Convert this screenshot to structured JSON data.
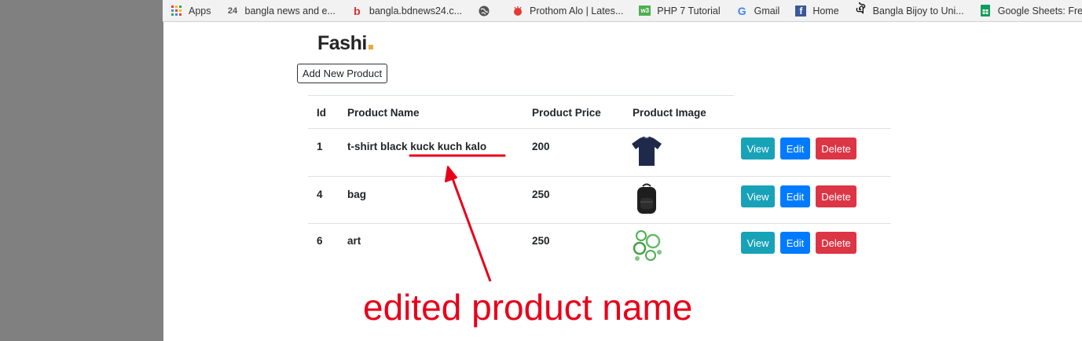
{
  "bookmarks": [
    {
      "label": "Apps",
      "icon": "apps-grid-icon"
    },
    {
      "label": "bangla news and e...",
      "icon": "news24-icon"
    },
    {
      "label": "bangla.bdnews24.c...",
      "icon": "bdnews-icon"
    },
    {
      "label": "",
      "icon": "globe-icon"
    },
    {
      "label": "Prothom Alo | Lates...",
      "icon": "prothomalo-icon"
    },
    {
      "label": "PHP 7 Tutorial",
      "icon": "w3-icon"
    },
    {
      "label": "Gmail",
      "icon": "google-icon"
    },
    {
      "label": "Home",
      "icon": "facebook-icon"
    },
    {
      "label": "Bangla Bijoy to Uni...",
      "icon": "bijoy-icon"
    },
    {
      "label": "Google Sheets: Free...",
      "icon": "sheets-icon"
    },
    {
      "label": "",
      "icon": "google-icon"
    }
  ],
  "brand": {
    "name": "Fashi",
    "dot_color": "#e7ab3c"
  },
  "add_button": "Add New Product",
  "table": {
    "headers": [
      "Id",
      "Product Name",
      "Product Price",
      "Product Image"
    ],
    "rows": [
      {
        "id": "1",
        "name": "t-shirt black kuck kuch kalo",
        "price": "200",
        "image": "tshirt-image"
      },
      {
        "id": "4",
        "name": "bag",
        "price": "250",
        "image": "backpack-image"
      },
      {
        "id": "6",
        "name": "art",
        "price": "250",
        "image": "art-image"
      }
    ],
    "actions": {
      "view": "View",
      "edit": "Edit",
      "delete": "Delete"
    }
  },
  "annotation": {
    "text": "edited product name",
    "color": "#e8001a"
  }
}
